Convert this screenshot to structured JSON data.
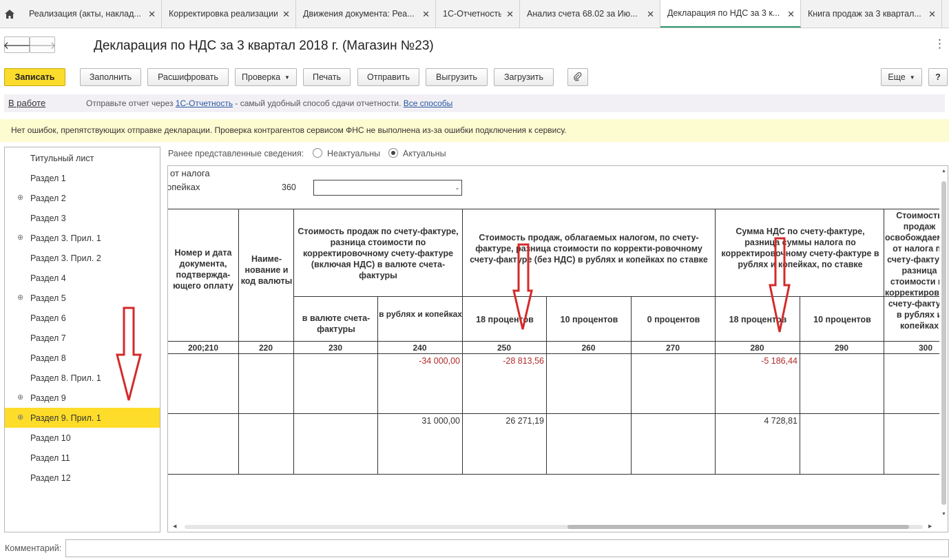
{
  "tabs": [
    {
      "label": "Реализация (акты, наклад...",
      "active": false
    },
    {
      "label": "Корректировка реализации",
      "active": false
    },
    {
      "label": "Движения документа: Реа...",
      "active": false
    },
    {
      "label": "1С-Отчетность",
      "active": false
    },
    {
      "label": "Анализ счета 68.02 за Ию...",
      "active": false
    },
    {
      "label": "Декларация по НДС за 3 к...",
      "active": true
    },
    {
      "label": "Книга продаж за 3 квартал...",
      "active": false
    }
  ],
  "header": {
    "title": "Декларация по НДС за 3 квартал 2018 г. (Магазин №23)",
    "back_icon": "arrow-left-icon",
    "forward_icon": "arrow-right-icon"
  },
  "toolbar": {
    "save": "Записать",
    "fill": "Заполнить",
    "decode": "Расшифровать",
    "check": "Проверка",
    "print": "Печать",
    "send": "Отправить",
    "export": "Выгрузить",
    "import": "Загрузить",
    "attach_icon": "paperclip-icon",
    "more": "Еще",
    "help": "?"
  },
  "status": {
    "state": "В работе",
    "msg_before": "Отправьте отчет через ",
    "msg_link": "1С-Отчетность",
    "msg_after": " - самый удобный способ сдачи отчетности. ",
    "msg_link2": "Все способы"
  },
  "notice": "Нет ошибок, препятствующих отправке декларации. Проверка контрагентов сервисом ФНС не выполнена из-за ошибки подключения к сервису.",
  "sections": [
    {
      "label": "Титульный лист",
      "expandable": false
    },
    {
      "label": "Раздел 1",
      "expandable": false
    },
    {
      "label": "Раздел 2",
      "expandable": true
    },
    {
      "label": "Раздел 3",
      "expandable": false
    },
    {
      "label": "Раздел 3. Прил. 1",
      "expandable": true
    },
    {
      "label": "Раздел 3. Прил. 2",
      "expandable": false
    },
    {
      "label": "Раздел 4",
      "expandable": false
    },
    {
      "label": "Раздел 5",
      "expandable": true
    },
    {
      "label": "Раздел 6",
      "expandable": false
    },
    {
      "label": "Раздел 7",
      "expandable": false
    },
    {
      "label": "Раздел 8",
      "expandable": false
    },
    {
      "label": "Раздел 8. Прил. 1",
      "expandable": false
    },
    {
      "label": "Раздел 9",
      "expandable": true
    },
    {
      "label": "Раздел 9. Прил. 1",
      "expandable": true,
      "selected": true
    },
    {
      "label": "Раздел 10",
      "expandable": false
    },
    {
      "label": "Раздел 11",
      "expandable": false
    },
    {
      "label": "Раздел 12",
      "expandable": false
    }
  ],
  "prev_info": {
    "label": "Ранее представленные сведения:",
    "opt1": "Неактуальны",
    "opt2": "Актуальны",
    "selected": "Актуальны"
  },
  "report": {
    "text1": "от налога",
    "text2": "опейках",
    "code360": "360",
    "field360": "-",
    "headers": {
      "h200": "Номер и дата документа, подтвержда-ющего оплату",
      "h220": "Наиме-нование и код валюты",
      "h230_240": "Стоимость продаж по счету-фактуре, разница стоимости по корректировочному счету-фактуре (включая НДС) в валюте счета-фактуры",
      "h230": "в валюте счета-фактуры",
      "h240": "в рублях и копейках",
      "h250_270": "Стоимость продаж, облагаемых налогом, по счету-фактуре, разница стоимости по корректи-ровочному счету-фактуре (без НДС) в рублях и копейках по ставке",
      "h250": "18 процентов",
      "h260": "10 процентов",
      "h270": "0 процентов",
      "h280_290": "Сумма НДС по счету-фактуре, разница суммы налога по корректировочному счету-фактуре в рублях и копейках, по ставке",
      "h280": "18 процентов",
      "h290": "10 процентов",
      "h300": "Стоимость продаж освобождаемых от налога по счету-фактуре, разница стоимости по корректировочному счету-фактуре в рублях и копейках"
    },
    "codes": [
      "200;210",
      "220",
      "230",
      "240",
      "250",
      "260",
      "270",
      "280",
      "290",
      "300"
    ],
    "rows": [
      {
        "c240": "-34 000,00",
        "c250": "-28 813,56",
        "c280": "-5 186,44"
      },
      {
        "c240": "31 000,00",
        "c250": "26 271,19",
        "c280": "4 728,81"
      }
    ]
  },
  "comment": {
    "label": "Комментарий:",
    "value": ""
  },
  "annotation_color": "#d42a2a"
}
